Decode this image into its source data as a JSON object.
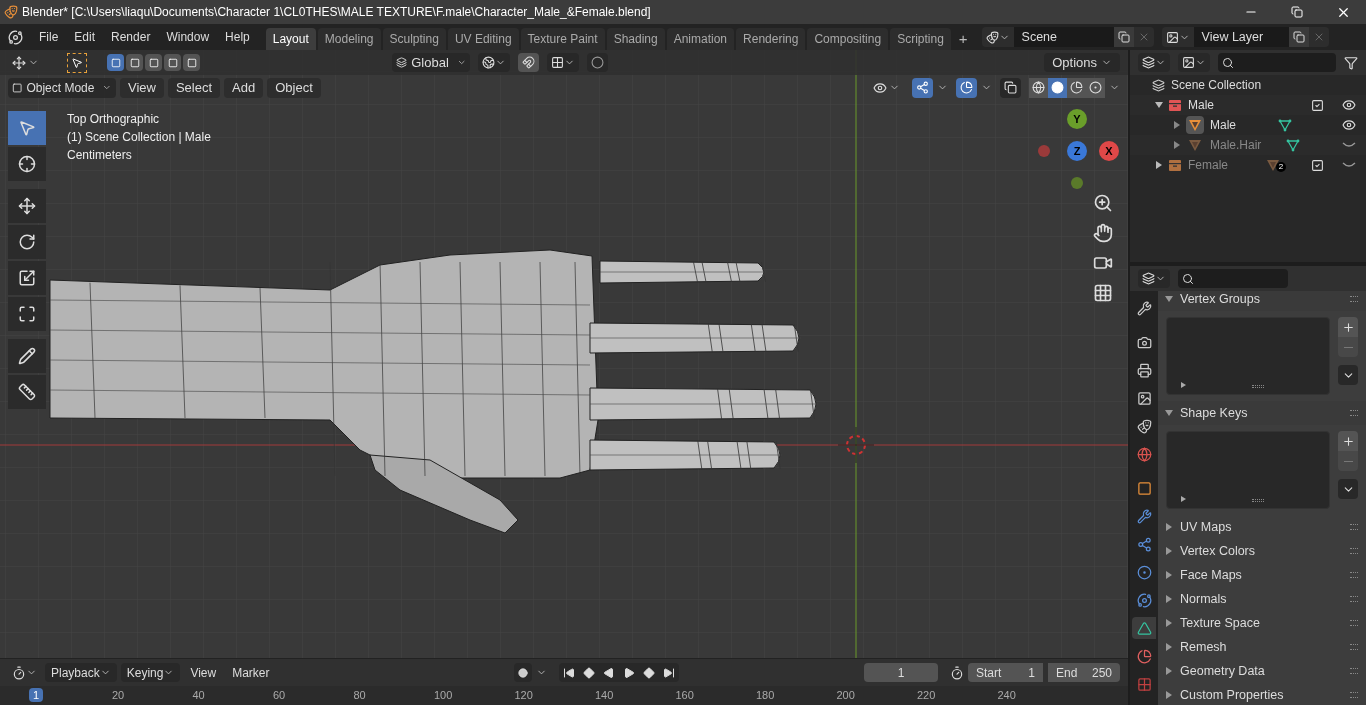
{
  "window": {
    "title": "Blender* [C:\\Users\\liaqu\\Documents\\Character 1\\CL0THES\\MALE TEXTURE\\F.male\\Character_Male_&Female.blend]"
  },
  "menu": [
    "File",
    "Edit",
    "Render",
    "Window",
    "Help"
  ],
  "workspace_tabs": [
    {
      "label": "Layout",
      "selected": true
    },
    {
      "label": "Modeling",
      "selected": false
    },
    {
      "label": "Sculpting",
      "selected": false
    },
    {
      "label": "UV Editing",
      "selected": false
    },
    {
      "label": "Texture Paint",
      "selected": false
    },
    {
      "label": "Shading",
      "selected": false
    },
    {
      "label": "Animation",
      "selected": false
    },
    {
      "label": "Rendering",
      "selected": false
    },
    {
      "label": "Compositing",
      "selected": false
    },
    {
      "label": "Scripting",
      "selected": false
    }
  ],
  "add_workspace": "+",
  "scene": {
    "value": "Scene"
  },
  "view_layer": {
    "value": "View Layer"
  },
  "tool_header": {
    "orientation": "Global",
    "options": "Options"
  },
  "viewport_header": {
    "mode": "Object Mode",
    "menus": [
      "View",
      "Select",
      "Add",
      "Object"
    ]
  },
  "shading_modes": [
    {
      "kind": "wireframe",
      "selected": false
    },
    {
      "kind": "solid",
      "selected": true
    },
    {
      "kind": "material",
      "selected": false
    },
    {
      "kind": "rendered",
      "selected": false
    }
  ],
  "overlay_text": [
    "Top Orthographic",
    "(1) Scene Collection | Male",
    "Centimeters"
  ],
  "toolbar": [
    {
      "kind": "select",
      "selected": true
    },
    {
      "kind": "cursor",
      "selected": false
    },
    {
      "kind": "move",
      "selected": false
    },
    {
      "kind": "rotate",
      "selected": false
    },
    {
      "kind": "scale",
      "selected": false
    },
    {
      "kind": "transform",
      "selected": false
    },
    {
      "kind": "annotate",
      "selected": false
    },
    {
      "kind": "measure",
      "selected": false
    }
  ],
  "gizmo": {
    "y": "Y",
    "z": "Z",
    "x": "X"
  },
  "outliner": {
    "root": "Scene Collection",
    "items": [
      {
        "name": "Male",
        "color": "#e05555",
        "expanded": true,
        "checked": true,
        "visible": true,
        "children": [
          {
            "name": "Male",
            "visible": true,
            "active": true
          },
          {
            "name": "Male.Hair",
            "visible": false,
            "active": false
          }
        ]
      },
      {
        "name": "Female",
        "color": "#b07040",
        "expanded": false,
        "checked": true,
        "visible": false,
        "badge": "2"
      }
    ]
  },
  "properties": {
    "tabs": [
      {
        "kind": "tool",
        "selected": false
      },
      {
        "kind": "render",
        "selected": false
      },
      {
        "kind": "output",
        "selected": false
      },
      {
        "kind": "view_layer",
        "selected": false
      },
      {
        "kind": "scene",
        "selected": false
      },
      {
        "kind": "world",
        "selected": false
      },
      {
        "kind": "object",
        "selected": false
      },
      {
        "kind": "modifiers",
        "selected": false
      },
      {
        "kind": "particles",
        "selected": false
      },
      {
        "kind": "physics",
        "selected": false
      },
      {
        "kind": "constraints",
        "selected": false
      },
      {
        "kind": "data",
        "selected": true
      },
      {
        "kind": "material",
        "selected": false
      },
      {
        "kind": "texture",
        "selected": false
      }
    ],
    "panels": [
      {
        "title": "Vertex Groups",
        "expanded": true
      },
      {
        "title": "Shape Keys",
        "expanded": true
      },
      {
        "title": "UV Maps",
        "expanded": false
      },
      {
        "title": "Vertex Colors",
        "expanded": false
      },
      {
        "title": "Face Maps",
        "expanded": false
      },
      {
        "title": "Normals",
        "expanded": false
      },
      {
        "title": "Texture Space",
        "expanded": false
      },
      {
        "title": "Remesh",
        "expanded": false
      },
      {
        "title": "Geometry Data",
        "expanded": false
      },
      {
        "title": "Custom Properties",
        "expanded": false
      }
    ]
  },
  "timeline": {
    "auto_keying": {
      "on": false
    },
    "menus": [
      "Playback",
      "Keying",
      "View",
      "Marker"
    ],
    "current_frame": "1",
    "start": {
      "label": "Start",
      "value": "1"
    },
    "end": {
      "label": "End",
      "value": "250"
    },
    "ruler": [
      "1",
      "20",
      "40",
      "60",
      "80",
      "100",
      "120",
      "140",
      "160",
      "180",
      "200",
      "220",
      "240"
    ]
  }
}
